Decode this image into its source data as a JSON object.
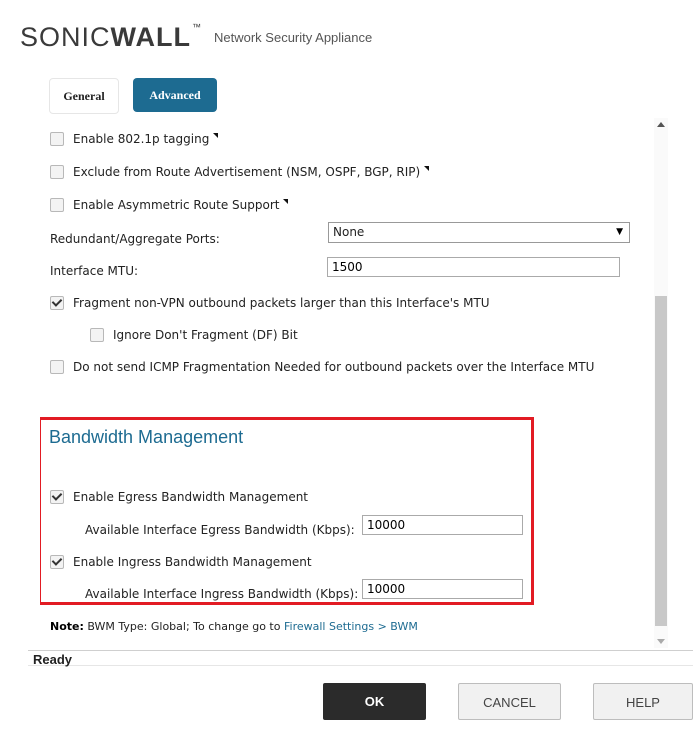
{
  "header": {
    "brand_sonic": "SONIC",
    "brand_wall": "WALL",
    "brand_tm": "™",
    "app_name": "Network Security Appliance"
  },
  "tabs": [
    {
      "label": "General",
      "active": false
    },
    {
      "label": "Advanced",
      "active": true
    }
  ],
  "options": {
    "vlan_tagging": {
      "label": "Enable 802.1p tagging",
      "checked": false
    },
    "exclude_route": {
      "label": "Exclude from Route Advertisement (NSM, OSPF, BGP, RIP)",
      "checked": false
    },
    "asym_route": {
      "label": "Enable Asymmetric Route Support",
      "checked": false
    },
    "redundant_ports": {
      "label": "Redundant/Aggregate Ports:",
      "value": "None"
    },
    "mtu": {
      "label": "Interface MTU:",
      "value": "1500"
    },
    "fragment": {
      "label": "Fragment non-VPN outbound packets larger than this Interface's MTU",
      "checked": true
    },
    "ignore_df": {
      "label": "Ignore Don't Fragment (DF) Bit",
      "checked": false
    },
    "no_icmp": {
      "label": "Do not send ICMP Fragmentation Needed for outbound packets over the Interface MTU",
      "checked": false
    }
  },
  "bandwidth": {
    "title": "Bandwidth Management",
    "egress_enable": {
      "label": "Enable Egress Bandwidth Management",
      "checked": true
    },
    "egress_bw": {
      "label": "Available Interface Egress Bandwidth (Kbps):",
      "value": "10000"
    },
    "ingress_enable": {
      "label": "Enable Ingress Bandwidth Management",
      "checked": true
    },
    "ingress_bw": {
      "label": "Available Interface Ingress Bandwidth (Kbps):",
      "value": "10000"
    }
  },
  "note": {
    "prefix": "Note:",
    "text": " BWM Type: Global; To change go to ",
    "link": "Firewall Settings > BWM"
  },
  "status": "Ready",
  "buttons": {
    "ok": "OK",
    "cancel": "CANCEL",
    "help": "HELP"
  },
  "colors": {
    "accent": "#1d6b91",
    "highlight_border": "#e21b23"
  }
}
